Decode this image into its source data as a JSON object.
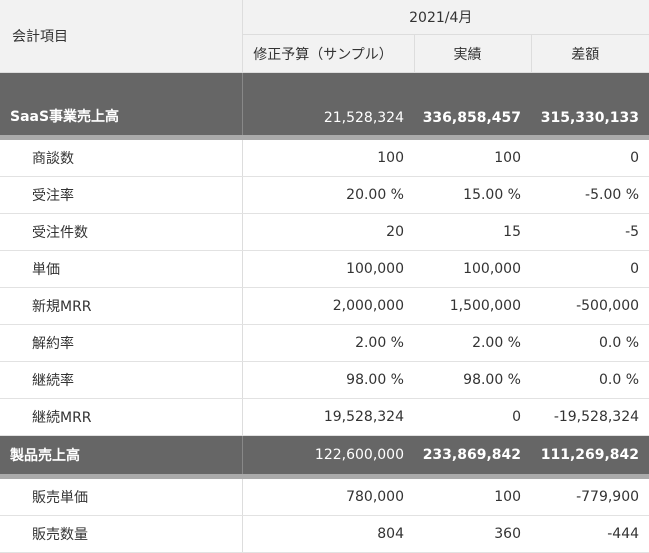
{
  "header": {
    "item_label": "会計項目",
    "period": "2021/4月",
    "columns": [
      "修正予算（サンプル）",
      "実績",
      "差額"
    ]
  },
  "rows": [
    {
      "type": "group",
      "label": "SaaS事業売上高",
      "plan": "21,528,324",
      "actual": "336,858,457",
      "diff": "315,330,133"
    },
    {
      "type": "item",
      "label": "商談数",
      "plan": "100",
      "actual": "100",
      "diff": "0"
    },
    {
      "type": "item",
      "label": "受注率",
      "plan": "20.00 %",
      "actual": "15.00 %",
      "diff": "-5.00 %"
    },
    {
      "type": "item",
      "label": "受注件数",
      "plan": "20",
      "actual": "15",
      "diff": "-5"
    },
    {
      "type": "item",
      "label": "単価",
      "plan": "100,000",
      "actual": "100,000",
      "diff": "0"
    },
    {
      "type": "item",
      "label": "新規MRR",
      "plan": "2,000,000",
      "actual": "1,500,000",
      "diff": "-500,000"
    },
    {
      "type": "item",
      "label": "解約率",
      "plan": "2.00 %",
      "actual": "2.00 %",
      "diff": "0.0 %"
    },
    {
      "type": "item",
      "label": "継続率",
      "plan": "98.00 %",
      "actual": "98.00 %",
      "diff": "0.0 %"
    },
    {
      "type": "item",
      "label": "継続MRR",
      "plan": "19,528,324",
      "actual": "0",
      "diff": "-19,528,324"
    },
    {
      "type": "group",
      "label": "製品売上高",
      "plan": "122,600,000",
      "actual": "233,869,842",
      "diff": "111,269,842"
    },
    {
      "type": "item",
      "label": "販売単価",
      "plan": "780,000",
      "actual": "100",
      "diff": "-779,900"
    },
    {
      "type": "item",
      "label": "販売数量",
      "plan": "804",
      "actual": "360",
      "diff": "-444"
    }
  ]
}
